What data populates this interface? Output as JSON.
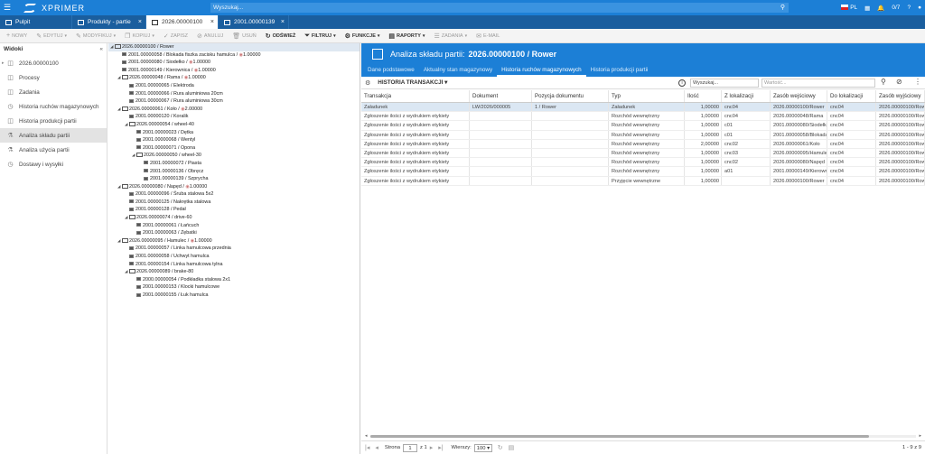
{
  "app": {
    "brand": "XPRIMER",
    "search_placeholder": "Wyszukaj...",
    "lang": "PL",
    "badge": "0/7",
    "accent": "#1c7fd6"
  },
  "tabs": [
    {
      "label": "Pulpit",
      "active": false
    },
    {
      "label": "Produkty - partie",
      "active": false
    },
    {
      "label": "2026.00000100",
      "active": true
    },
    {
      "label": "2001.00000139",
      "active": false
    }
  ],
  "toolbar": [
    {
      "label": "Nowy",
      "icon": "+",
      "enabled": false
    },
    {
      "label": "Edytuj",
      "icon": "✎",
      "enabled": false,
      "caret": true
    },
    {
      "label": "Modyfikuj",
      "icon": "✎",
      "enabled": false,
      "caret": true
    },
    {
      "label": "Kopiuj",
      "icon": "❐",
      "enabled": false,
      "caret": true
    },
    {
      "label": "Zapisz",
      "icon": "✓",
      "enabled": false
    },
    {
      "label": "Anuluj",
      "icon": "⊘",
      "enabled": false
    },
    {
      "label": "Usuń",
      "icon": "🗑",
      "enabled": false
    },
    {
      "label": "Odśwież",
      "icon": "↻",
      "enabled": true
    },
    {
      "label": "Filtruj",
      "icon": "⏷",
      "enabled": true,
      "caret": true
    },
    {
      "label": "Funkcje",
      "icon": "⚙",
      "enabled": true,
      "caret": true
    },
    {
      "label": "Raporty",
      "icon": "▤",
      "enabled": true,
      "caret": true
    },
    {
      "label": "Zadania",
      "icon": "☰",
      "enabled": false,
      "caret": true
    },
    {
      "label": "E-mail",
      "icon": "✉",
      "enabled": false
    }
  ],
  "sidebar": {
    "title": "Widoki",
    "items": [
      {
        "label": "2026.00000100",
        "icon": "◫",
        "expand": true,
        "active": false
      },
      {
        "label": "Procesy",
        "icon": "◫",
        "active": false
      },
      {
        "label": "Zadania",
        "icon": "◫",
        "active": false
      },
      {
        "label": "Historia ruchów magazynowych",
        "icon": "◷",
        "active": false
      },
      {
        "label": "Historia produkcji partii",
        "icon": "◫",
        "active": false
      },
      {
        "label": "Analiza składu partii",
        "icon": "⚗",
        "active": true
      },
      {
        "label": "Analiza użycia partii",
        "icon": "⚗",
        "active": false
      },
      {
        "label": "Dostawy i wysyłki",
        "icon": "◷",
        "active": false
      }
    ]
  },
  "tree": [
    {
      "d": 0,
      "t": "folder",
      "label": "2026.00000100 / Rower",
      "root": true
    },
    {
      "d": 1,
      "t": "item",
      "label": "2001.00000058 / Blokada fiszka zacisku hamulca / ",
      "qty": "1.00000"
    },
    {
      "d": 1,
      "t": "item",
      "label": "2001.00000080 / Siodełko / ",
      "qty": "1.00000"
    },
    {
      "d": 1,
      "t": "item",
      "label": "2001.00000149 / Kierownica / ",
      "qty": "1.00000"
    },
    {
      "d": 1,
      "t": "folder",
      "label": "2026.00000048 / Rama / ",
      "qty": "1.00000"
    },
    {
      "d": 2,
      "t": "item",
      "label": "2001.00000065 / Elektroda"
    },
    {
      "d": 2,
      "t": "item",
      "label": "2001.00000066 / Rura aluminiowa 20cm"
    },
    {
      "d": 2,
      "t": "item",
      "label": "2001.00000067 / Rura aluminiowa 30cm"
    },
    {
      "d": 1,
      "t": "folder",
      "label": "2026.00000061 / Koło / ",
      "qty": "2.00000"
    },
    {
      "d": 2,
      "t": "item",
      "label": "2001.00000120 / Koralik"
    },
    {
      "d": 2,
      "t": "folder",
      "label": "2026.00000054 / wheel-40"
    },
    {
      "d": 3,
      "t": "item",
      "label": "2001.00000023 / Dętka"
    },
    {
      "d": 3,
      "t": "item",
      "label": "2001.00000068 / Wentyl"
    },
    {
      "d": 3,
      "t": "item",
      "label": "2001.00000071 / Opona"
    },
    {
      "d": 3,
      "t": "folder",
      "label": "2026.00000050 / wheel-30"
    },
    {
      "d": 4,
      "t": "item",
      "label": "2001.00000072 / Piasta"
    },
    {
      "d": 4,
      "t": "item",
      "label": "2001.00000136 / Obręcz"
    },
    {
      "d": 4,
      "t": "item",
      "label": "2001.00000139 / Szprycha"
    },
    {
      "d": 1,
      "t": "folder",
      "label": "2026.00000080 / Napęd / ",
      "qty": "1.00000"
    },
    {
      "d": 2,
      "t": "item",
      "label": "2001.00000096 / Śruba stalowa 5x2"
    },
    {
      "d": 2,
      "t": "item",
      "label": "2001.00000125 / Nakrętka stalowa"
    },
    {
      "d": 2,
      "t": "item",
      "label": "2001.00000128 / Pedał"
    },
    {
      "d": 2,
      "t": "folder",
      "label": "2026.00000074 / drive-60"
    },
    {
      "d": 3,
      "t": "item",
      "label": "2001.00000061 / Łańcuch"
    },
    {
      "d": 3,
      "t": "item",
      "label": "2001.00000063 / Zębatki"
    },
    {
      "d": 1,
      "t": "folder",
      "label": "2026.00000095 / Hamulec / ",
      "qty": "1.00000"
    },
    {
      "d": 2,
      "t": "item",
      "label": "2001.00000057 / Linka hamulcowa przednia"
    },
    {
      "d": 2,
      "t": "item",
      "label": "2001.00000058 / Uchwyt hamulca"
    },
    {
      "d": 2,
      "t": "item",
      "label": "2001.00000154 / Linka hamulcowa tylna"
    },
    {
      "d": 2,
      "t": "folder",
      "label": "2026.00000089 / brake-80"
    },
    {
      "d": 3,
      "t": "item",
      "label": "2000.00000054 / Podkładka stalowa 2x1"
    },
    {
      "d": 3,
      "t": "item",
      "label": "2001.00000153 / Klocki hamulcowe"
    },
    {
      "d": 3,
      "t": "item",
      "label": "2001.00000155 / Łuk hamulca"
    }
  ],
  "main": {
    "title_prefix": "Analiza składu partii:",
    "title": "2026.00000100 / Rower",
    "subtabs": [
      {
        "label": "Dane podstawowe",
        "active": false
      },
      {
        "label": "Aktualny stan magazynowy",
        "active": false
      },
      {
        "label": "Historia ruchów magazynowych",
        "active": true
      },
      {
        "label": "Historia produkcji partii",
        "active": false
      }
    ],
    "section": "HISTORIA TRANSAKCJI",
    "filter_select": "Wyszukaj...",
    "filter_value_placeholder": "Wartość...",
    "columns": [
      "Transakcja",
      "Dokument",
      "Pozycja dokumentu",
      "Typ",
      "Ilość",
      "Z lokalizacji",
      "Zasób wejściowy",
      "Do lokalizacji",
      "Zasób wyjściowy"
    ],
    "rows": [
      [
        "Załadunek",
        "LW/2026/000005",
        "1 / Rower",
        "Załadunek",
        "1,00000",
        "cnc04",
        "2026.00000100/Rower",
        "cnc04",
        "2026.00000100/Rower"
      ],
      [
        "Zgłoszenie ilości z wydrukiem etykiety",
        "",
        "",
        "Rozchód wewnętrzny",
        "1,00000",
        "cnc04",
        "2026.00000048/Rama",
        "cnc04",
        "2026.00000100/Rower"
      ],
      [
        "Zgłoszenie ilości z wydrukiem etykiety",
        "",
        "",
        "Rozchód wewnętrzny",
        "1,00000",
        "c01",
        "2001.00000080/Siodełko",
        "cnc04",
        "2026.00000100/Rower"
      ],
      [
        "Zgłoszenie ilości z wydrukiem etykiety",
        "",
        "",
        "Rozchód wewnętrzny",
        "1,00000",
        "c01",
        "2001.00000058/Blokada",
        "cnc04",
        "2026.00000100/Rower"
      ],
      [
        "Zgłoszenie ilości z wydrukiem etykiety",
        "",
        "",
        "Rozchód wewnętrzny",
        "2,00000",
        "cnc02",
        "2026.00000061/Koło",
        "cnc04",
        "2026.00000100/Rower"
      ],
      [
        "Zgłoszenie ilości z wydrukiem etykiety",
        "",
        "",
        "Rozchód wewnętrzny",
        "1,00000",
        "cnc03",
        "2026.00000095/Hamulec",
        "cnc04",
        "2026.00000100/Rower"
      ],
      [
        "Zgłoszenie ilości z wydrukiem etykiety",
        "",
        "",
        "Rozchód wewnętrzny",
        "1,00000",
        "cnc02",
        "2026.00000080/Napęd",
        "cnc04",
        "2026.00000100/Rower"
      ],
      [
        "Zgłoszenie ilości z wydrukiem etykiety",
        "",
        "",
        "Rozchód wewnętrzny",
        "1,00000",
        "a01",
        "2001.00000149/Kierownica",
        "cnc04",
        "2026.00000100/Rower"
      ],
      [
        "Zgłoszenie ilości z wydrukiem etykiety",
        "",
        "",
        "Przyjęcie wewnętrzne",
        "1,00000",
        "",
        "2026.00000100/Rower",
        "cnc04",
        "2026.00000100/Rower"
      ]
    ]
  },
  "pager": {
    "page_label": "Strona",
    "page": "1",
    "of": "z 1",
    "rows_label": "Wierszy:",
    "rows": "100",
    "count": "1 - 9 z 9"
  }
}
